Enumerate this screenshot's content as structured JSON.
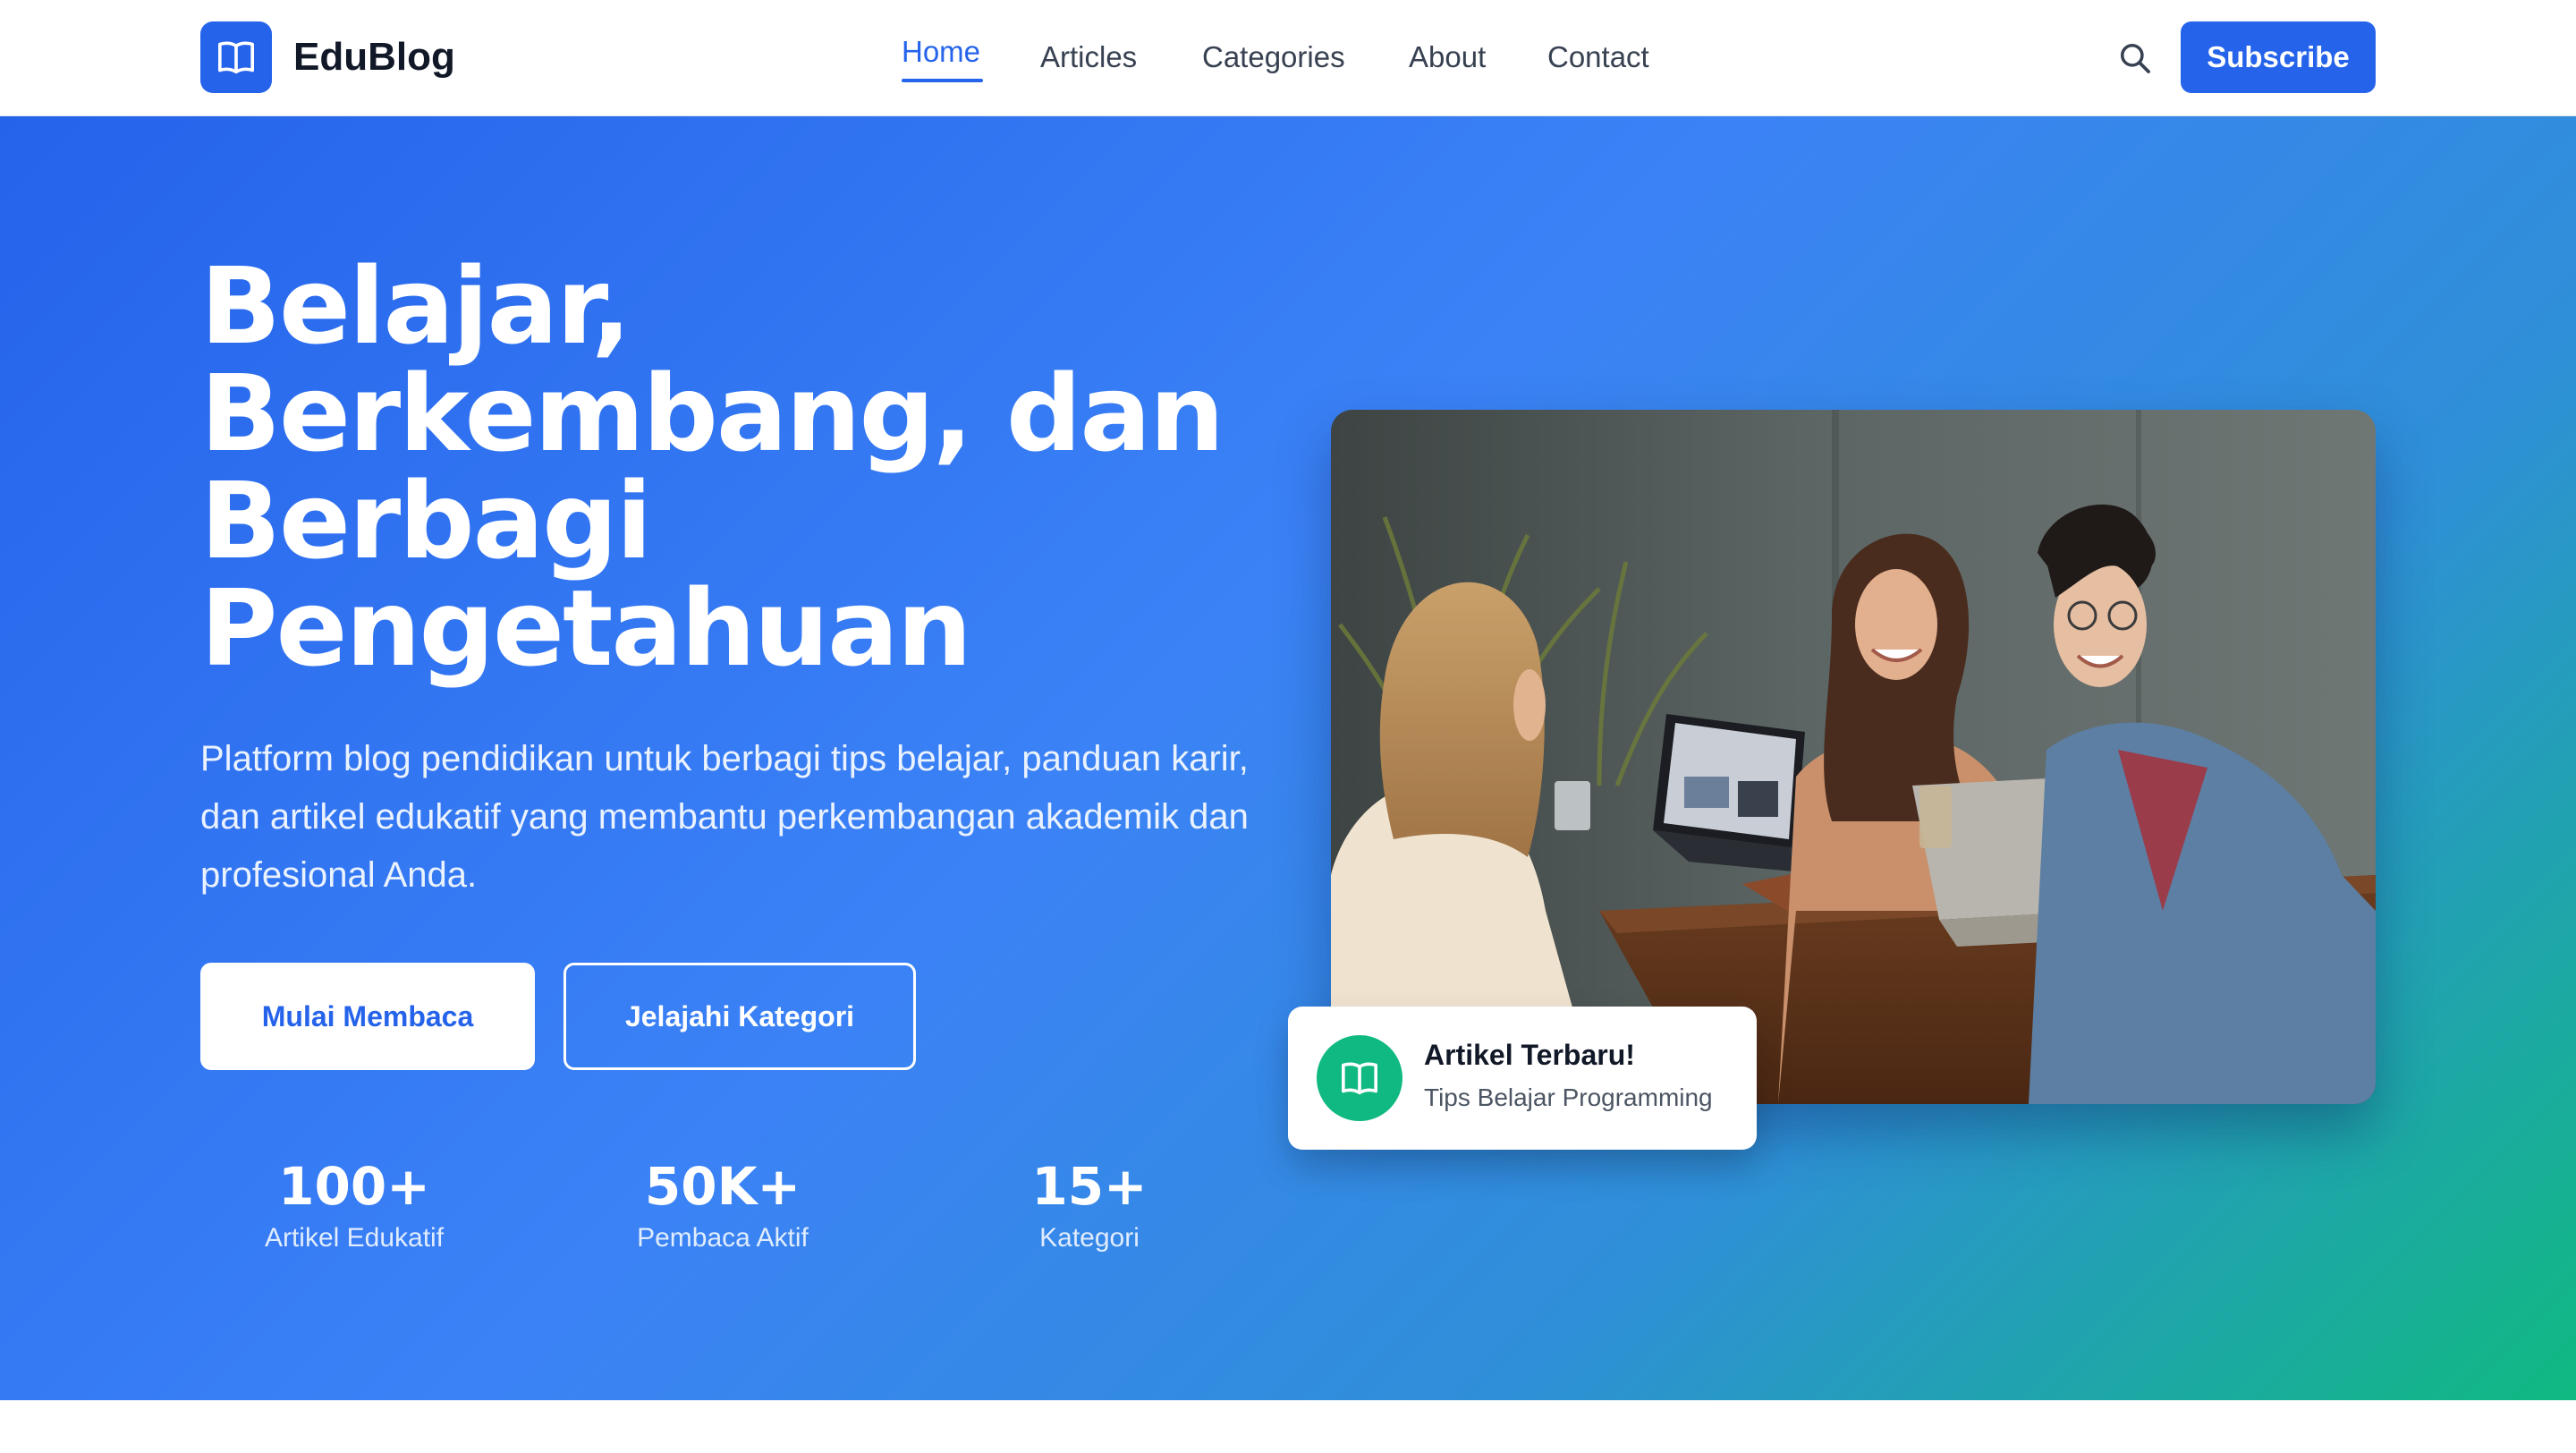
{
  "brand": {
    "name": "EduBlog",
    "icon": "book-open-icon",
    "primary_color": "#2563eb",
    "accent_color": "#10b981"
  },
  "nav": {
    "items": [
      {
        "label": "Home",
        "active": true
      },
      {
        "label": "Articles",
        "active": false
      },
      {
        "label": "Categories",
        "active": false
      },
      {
        "label": "About",
        "active": false
      },
      {
        "label": "Contact",
        "active": false
      }
    ],
    "search_icon": "search-icon",
    "subscribe_label": "Subscribe"
  },
  "hero": {
    "title_lines": [
      "Belajar,",
      "Berkembang, dan",
      "Berbagi",
      "Pengetahuan"
    ],
    "description": "Platform blog pendidikan untuk berbagi tips belajar, panduan karir, dan artikel edukatif yang membantu perkembangan akademik dan profesional Anda.",
    "primary_cta": "Mulai Membaca",
    "secondary_cta": "Jelajahi Kategori",
    "stats": [
      {
        "value": "100+",
        "label": "Artikel Edukatif"
      },
      {
        "value": "50K+",
        "label": "Pembaca Aktif"
      },
      {
        "value": "15+",
        "label": "Kategori"
      }
    ],
    "image_subject": "three-students-laughing-at-cafe-table-with-laptops",
    "notification": {
      "icon": "book-open-icon",
      "title": "Artikel Terbaru!",
      "subtitle": "Tips Belajar Programming"
    }
  }
}
